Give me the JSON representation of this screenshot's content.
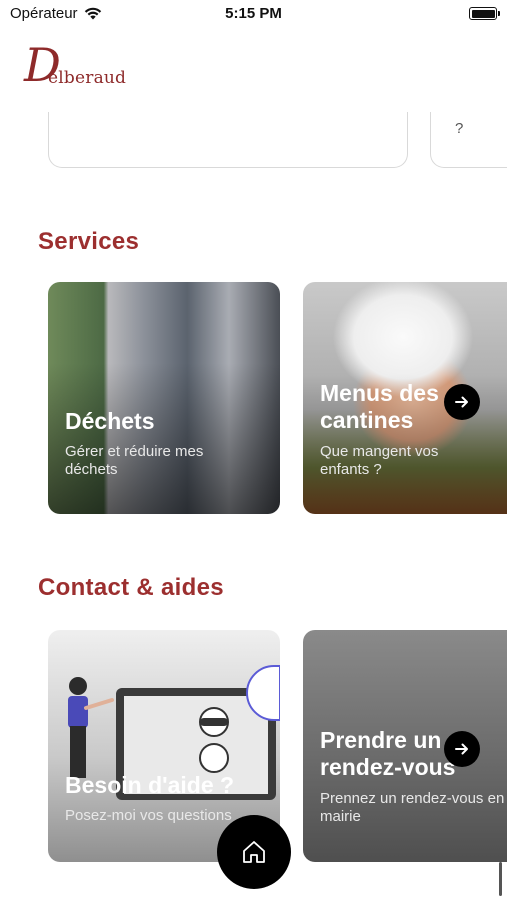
{
  "status_bar": {
    "carrier": "Opérateur",
    "time": "5:15 PM",
    "icons": [
      "wifi-icon",
      "battery-icon"
    ]
  },
  "logo": {
    "initial": "D",
    "rest": "elberaud"
  },
  "top_cards": {
    "second_text": "?"
  },
  "sections": {
    "services": {
      "title": "Services",
      "cards": [
        {
          "title": "Déchets",
          "subtitle": "Gérer et réduire mes déchets"
        },
        {
          "title": "Menus des cantines",
          "subtitle": "Que mangent vos enfants ?"
        }
      ]
    },
    "contact": {
      "title": "Contact & aides",
      "cards": [
        {
          "title": "Besoin d'aide ?",
          "subtitle": "Posez-moi vos questions"
        },
        {
          "title": "Prendre un rendez-vous",
          "subtitle": "Prennez un rendez-vous en mairie"
        }
      ]
    }
  },
  "colors": {
    "accent": "#9c2f2f",
    "fab": "#000000"
  },
  "fab": {
    "icon": "home-icon"
  }
}
